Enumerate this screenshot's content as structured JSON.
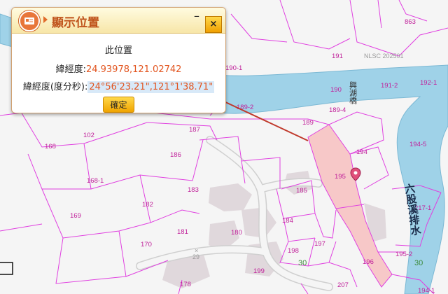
{
  "popup": {
    "title": "顯示位置",
    "minimize_label": "–",
    "close_label": "×",
    "heading": "此位置",
    "decimal_label": "緯經度:",
    "decimal_value": "24.93978,121.02742",
    "dms_label": "緯經度(度分秒):",
    "dms_value": "24°56'23.21\",121°1'38.71\"",
    "confirm_label": "確定"
  },
  "map": {
    "bridge_name": "興湖橋",
    "river_name": "六股溪排水",
    "watermark": "NLSC 202501",
    "road_numbers": [
      "30",
      "30",
      "29"
    ],
    "parcel_numbers": [
      "863",
      "191",
      "190-1",
      "190",
      "191-2",
      "192-1",
      "189-2",
      "189-4",
      "189",
      "187",
      "102",
      "168",
      "186",
      "194",
      "194-5",
      "195",
      "168-1",
      "183",
      "185",
      "182",
      "184",
      "217-1",
      "169",
      "181",
      "180",
      "170",
      "198",
      "197",
      "196",
      "195-2",
      "199",
      "178",
      "207",
      "194-1"
    ]
  },
  "colors": {
    "river": "#9fd2e8",
    "parcel_line": "#e040e0",
    "highlight_parcel": "#f7c8c8",
    "marker": "#e0507a",
    "pointer_arrow": "#c0392b"
  }
}
